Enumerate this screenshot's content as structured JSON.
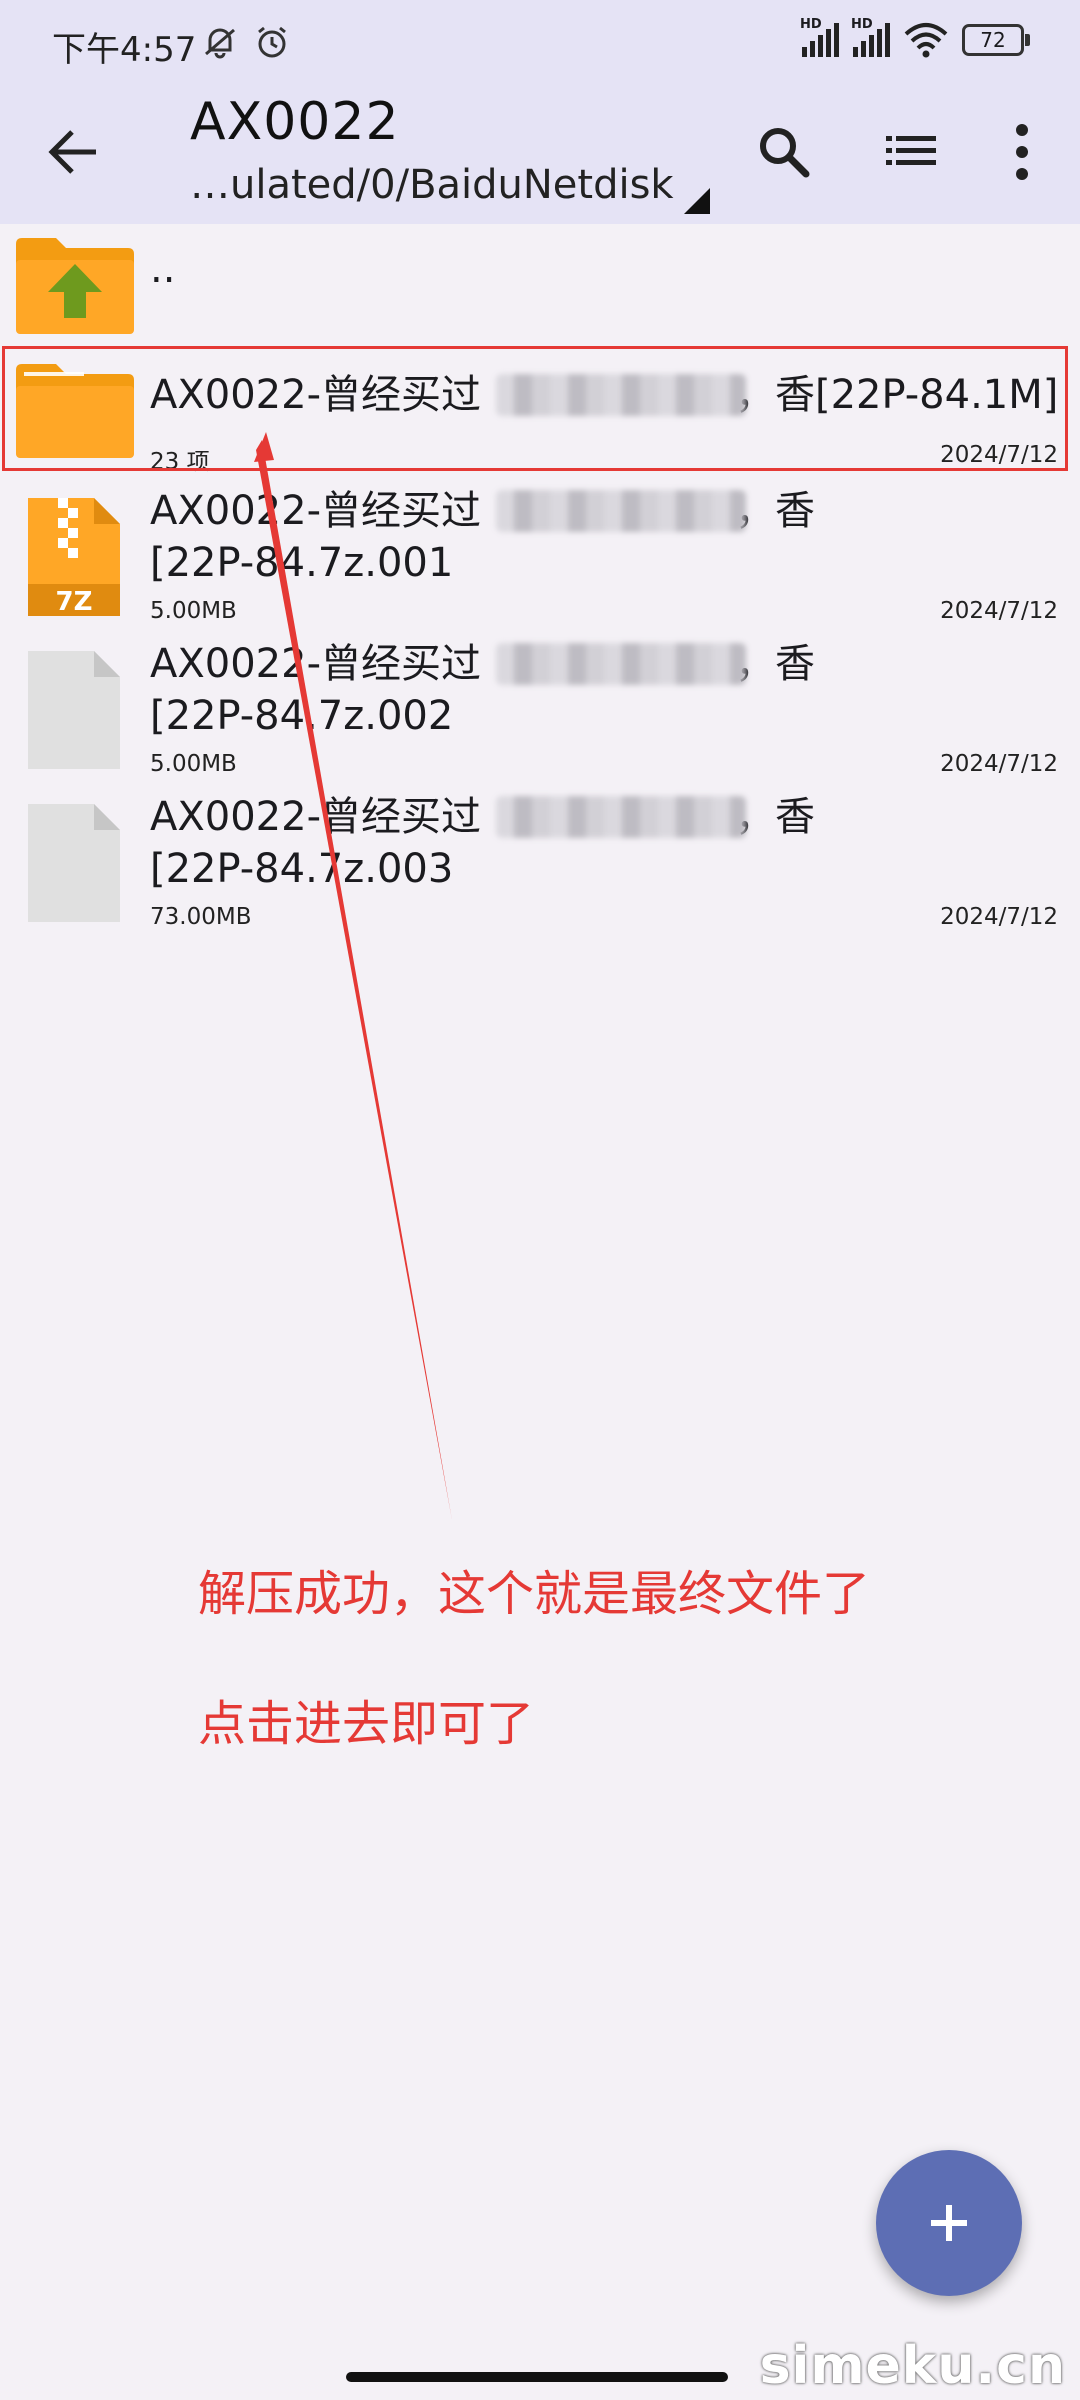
{
  "status_bar": {
    "time": "下午4:57",
    "battery": "72",
    "hd_label": "HD"
  },
  "toolbar": {
    "title": "AX0022",
    "path": "…ulated/0/BaiduNetdisk",
    "back_icon": "arrow-left-icon",
    "search_icon": "search-icon",
    "list_view_icon": "list-view-icon",
    "more_icon": "more-vert-icon"
  },
  "up_item": {
    "label": ".."
  },
  "files": [
    {
      "line1": "AX0022-曾经买过",
      "tail": "，香[22P-84.1M]",
      "line2": "",
      "meta": "23 项",
      "date": "2024/7/12",
      "icon": "folder-icon"
    },
    {
      "line1": "AX0022-曾经买过",
      "tail": "，香",
      "line2": "[22P-84.7z.001",
      "meta": "5.00MB",
      "date": "2024/7/12",
      "icon": "7z-archive-icon",
      "icon_text": "7Z"
    },
    {
      "line1": "AX0022-曾经买过",
      "tail": "，香",
      "line2": "[22P-84.7z.002",
      "meta": "5.00MB",
      "date": "2024/7/12",
      "icon": "file-icon"
    },
    {
      "line1": "AX0022-曾经买过",
      "tail": "，香",
      "line2": "[22P-84.7z.003",
      "meta": "73.00MB",
      "date": "2024/7/12",
      "icon": "file-icon"
    }
  ],
  "annotation": {
    "line1": "解压成功，这个就是最终文件了",
    "line2": "点击进去即可了"
  },
  "fab": {
    "icon": "plus-icon"
  },
  "watermark": "simeku.cn",
  "colors": {
    "appbar": "#e5e3f5",
    "folder": "#ffa726",
    "accent_fab": "#5d6eb4",
    "annotation": "#e53935"
  }
}
